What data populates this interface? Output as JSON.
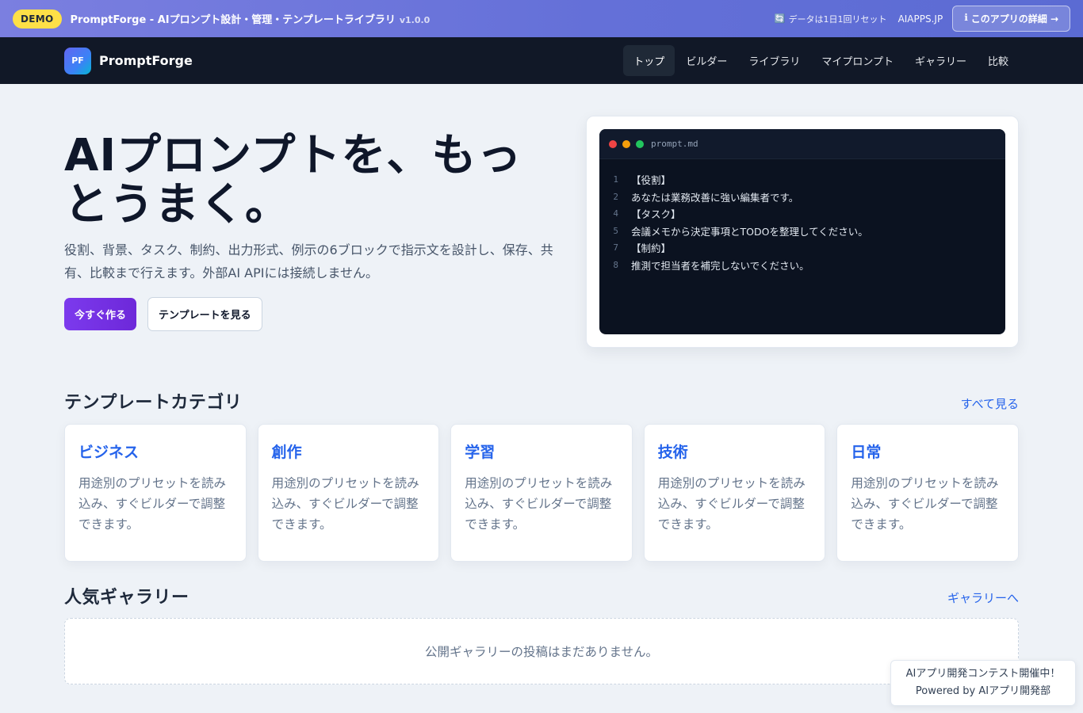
{
  "demo_bar": {
    "badge": "DEMO",
    "title": "PromptForge - AIプロンプト設計・管理・テンプレートライブラリ",
    "version": "v1.0.0",
    "reset_icon": "🔄",
    "reset_text": "データは1日1回リセット",
    "site": "AIAPPS.JP",
    "detail_icon": "ℹ",
    "detail_label": "このアプリの詳細 →"
  },
  "nav": {
    "logo_mark": "PF",
    "logo_text": "PromptForge",
    "links": [
      {
        "label": "トップ",
        "active": true
      },
      {
        "label": "ビルダー"
      },
      {
        "label": "ライブラリ"
      },
      {
        "label": "マイプロンプト"
      },
      {
        "label": "ギャラリー"
      },
      {
        "label": "比較"
      }
    ]
  },
  "hero": {
    "title": "AIプロンプトを、もっとうまく。",
    "subtitle": "役割、背景、タスク、制約、出力形式、例示の6ブロックで指示文を設計し、保存、共有、比較まで行えます。外部AI APIには接続しません。",
    "primary_cta": "今すぐ作る",
    "secondary_cta": "テンプレートを見る"
  },
  "preview": {
    "filename": "prompt.md",
    "lines": [
      {
        "no": "1",
        "text": "【役割】"
      },
      {
        "no": "2",
        "text": "あなたは業務改善に強い編集者です。"
      },
      {
        "no": "4",
        "text": "【タスク】"
      },
      {
        "no": "5",
        "text": "会議メモから決定事項とTODOを整理してください。"
      },
      {
        "no": "7",
        "text": "【制約】"
      },
      {
        "no": "8",
        "text": "推測で担当者を補完しないでください。"
      }
    ]
  },
  "categories": {
    "title": "テンプレートカテゴリ",
    "see_all": "すべて見る",
    "items": [
      {
        "name": "ビジネス",
        "desc": "用途別のプリセットを読み込み、すぐビルダーで調整できます。"
      },
      {
        "name": "創作",
        "desc": "用途別のプリセットを読み込み、すぐビルダーで調整できます。"
      },
      {
        "name": "学習",
        "desc": "用途別のプリセットを読み込み、すぐビルダーで調整できます。"
      },
      {
        "name": "技術",
        "desc": "用途別のプリセットを読み込み、すぐビルダーで調整できます。"
      },
      {
        "name": "日常",
        "desc": "用途別のプリセットを読み込み、すぐビルダーで調整できます。"
      }
    ]
  },
  "gallery": {
    "title": "人気ギャラリー",
    "link": "ギャラリーへ",
    "empty": "公開ギャラリーの投稿はまだありません。"
  },
  "contest": {
    "line1": "AIアプリ開発コンテスト開催中！",
    "line2": "Powered by AIアプリ開発部"
  },
  "colors": {
    "accent": "#2563eb",
    "primary_button": "#7c3aed",
    "nav_bg": "#111827",
    "demo_badge": "#fde047"
  }
}
